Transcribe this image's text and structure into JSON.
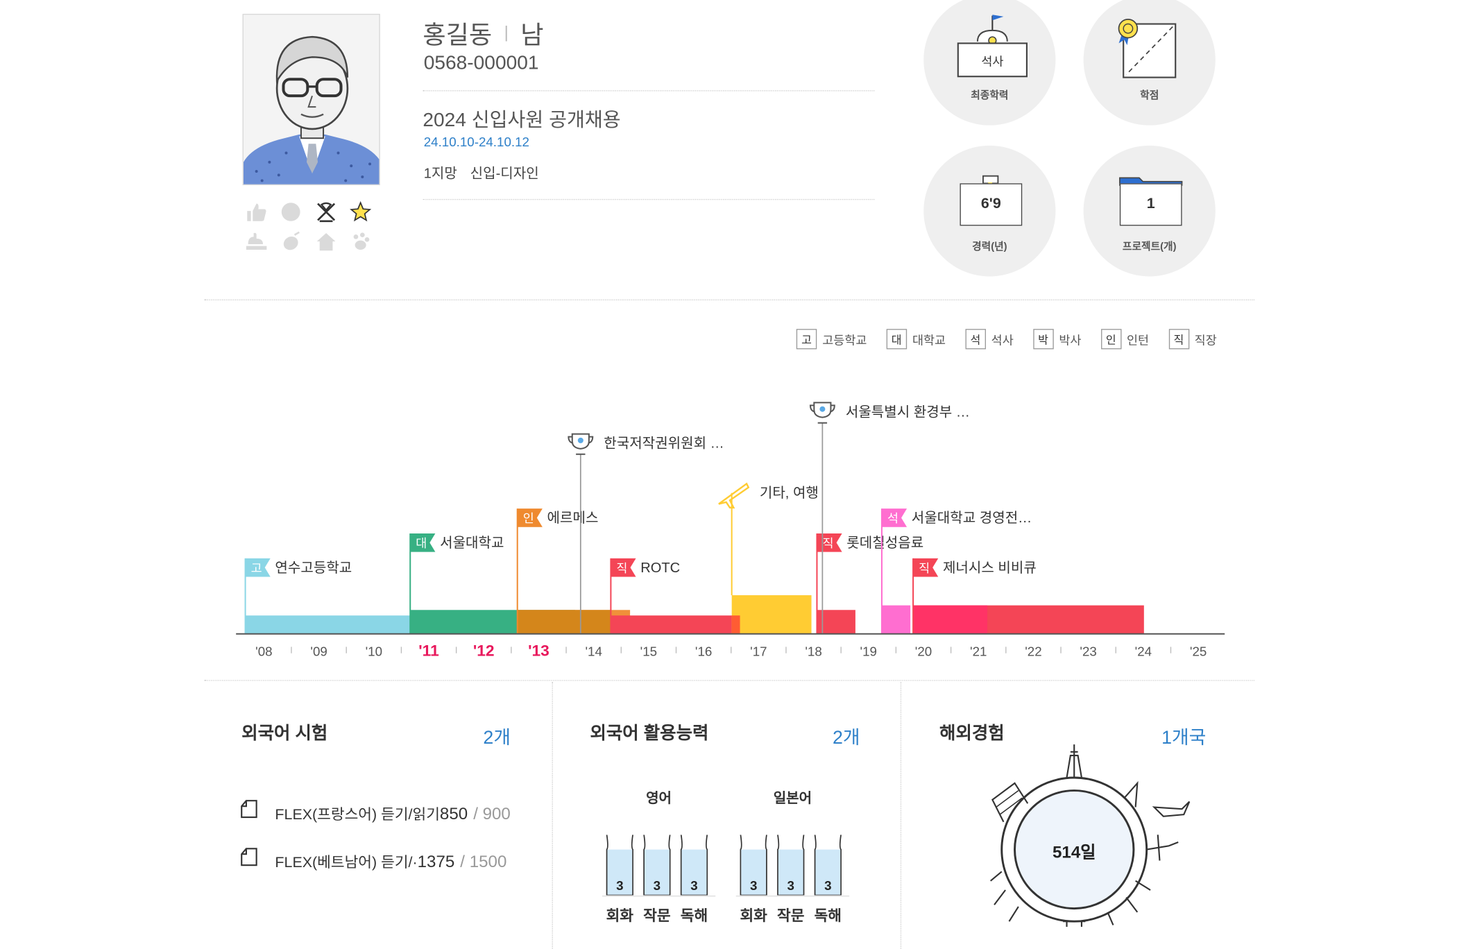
{
  "profile": {
    "name": "홍길동",
    "gender": "남",
    "resume_no": "0568-000001"
  },
  "job": {
    "title": "2024 신입사원 공개채용",
    "period": "24.10.10-24.10.12",
    "preference": "1지망",
    "position": "신입-디자인"
  },
  "profile_icons": [
    "thumbs-up-icon",
    "circle-icon",
    "crossed-flags-icon",
    "star-icon",
    "hand-icon",
    "mouse-icon",
    "home-icon",
    "paw-icon"
  ],
  "stats": {
    "education": {
      "box_text": "석사",
      "label": "최종학력"
    },
    "gpa": {
      "box_text": "",
      "label": "학점"
    },
    "career": {
      "box_text": "6'9",
      "label": "경력(년)"
    },
    "project": {
      "box_text": "1",
      "label": "프로젝트(개)"
    }
  },
  "legend": [
    {
      "badge": "고",
      "label": "고등학교"
    },
    {
      "badge": "대",
      "label": "대학교"
    },
    {
      "badge": "석",
      "label": "석사"
    },
    {
      "badge": "박",
      "label": "박사"
    },
    {
      "badge": "인",
      "label": "인턴"
    },
    {
      "badge": "직",
      "label": "직장"
    }
  ],
  "timeline": {
    "years": [
      "'08",
      "'09",
      "'10",
      "'11",
      "'12",
      "'13",
      "'14",
      "'15",
      "'16",
      "'17",
      "'18",
      "'19",
      "'20",
      "'21",
      "'22",
      "'23",
      "'24",
      "'25"
    ],
    "highlight_years": [
      "'11",
      "'12",
      "'13"
    ],
    "colors": {
      "highschool": "#8ad6e6",
      "university": "#37b083",
      "intern": "#ef8a2f",
      "job": "#f44556",
      "master": "#ff6ed0",
      "travel": "#ffcc33",
      "award": "#999999",
      "highlight": "#e8185c"
    },
    "events": [
      {
        "badge": "고",
        "label": "연수고등학교",
        "kind": "highschool",
        "start": 2008.0,
        "end": 2011.0,
        "level": 1
      },
      {
        "badge": "대",
        "label": "서울대학교",
        "kind": "university",
        "start": 2011.0,
        "end": 2014.0,
        "level": 2
      },
      {
        "badge": "인",
        "label": "에르메스",
        "kind": "intern",
        "start": 2012.95,
        "end": 2015.0,
        "level": 3
      },
      {
        "badge": "직",
        "label": "ROTC",
        "kind": "job",
        "start": 2014.65,
        "end": 2017.0,
        "level": 1
      },
      {
        "badge": "",
        "label": "기타, 여행",
        "kind": "travel",
        "start": 2016.85,
        "end": 2018.3,
        "level": 4
      },
      {
        "badge": "직",
        "label": "롯데칠성음료",
        "kind": "job",
        "start": 2018.4,
        "end": 2019.1,
        "level": 2
      },
      {
        "badge": "석",
        "label": "서울대학교 경영전…",
        "kind": "master",
        "start": 2019.58,
        "end": 2020.1,
        "level": 3
      },
      {
        "badge": "직",
        "label": "제너시스 비비큐",
        "kind": "job",
        "start": 2020.15,
        "end": 2024.35,
        "level": 1
      }
    ],
    "awards": [
      {
        "label": "한국저작권위원회 …",
        "year": 2014.1
      },
      {
        "label": "서울특별시 환경부 …",
        "year": 2018.5
      }
    ]
  },
  "foreign_tests": {
    "title": "외국어 시험",
    "count": "2개",
    "items": [
      {
        "name": "FLEX(프랑스어) 듣기/읽기",
        "score": "850",
        "max": "900"
      },
      {
        "name": "FLEX(베트남어) 듣기/·",
        "score": "1375",
        "max": "1500"
      }
    ]
  },
  "language_skills": {
    "title": "외국어 활용능력",
    "count": "2개",
    "languages": [
      {
        "name": "영어",
        "skills": [
          {
            "label": "회화",
            "level": "3"
          },
          {
            "label": "작문",
            "level": "3"
          },
          {
            "label": "독해",
            "level": "3"
          }
        ]
      },
      {
        "name": "일본어",
        "skills": [
          {
            "label": "회화",
            "level": "3"
          },
          {
            "label": "작문",
            "level": "3"
          },
          {
            "label": "독해",
            "level": "3"
          }
        ]
      }
    ]
  },
  "overseas": {
    "title": "해외경험",
    "count": "1개국",
    "days": "514일"
  }
}
